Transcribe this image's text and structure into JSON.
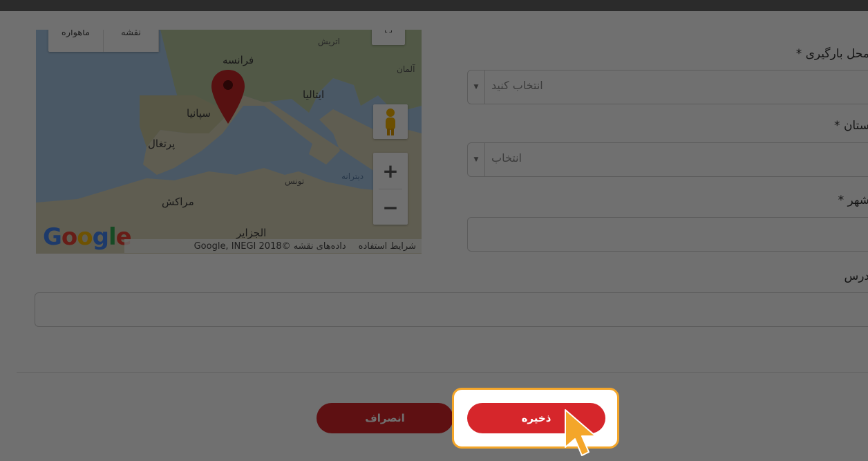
{
  "form": {
    "loading_place_label": "محل بارگیری *",
    "loading_place_placeholder": "انتخاب کنید",
    "province_label": "ستان *",
    "province_placeholder": "انتخاب",
    "city_label": "شهر *",
    "city_value": "",
    "address_label": "درس",
    "address_value": ""
  },
  "map": {
    "type_tabs": [
      "ماهواره",
      "نقشه"
    ],
    "places": {
      "france": "فرانسه",
      "spain": "سپانیا",
      "portugal": "پرتغال",
      "italy": "ایتالیا",
      "morocco": "مراکش",
      "tunisia": "تونس",
      "algeria": "الجزایر",
      "germany": "آلمان",
      "austria": "اتریش",
      "med_sea": "دیترانه"
    },
    "google_logo": "Google",
    "attribution_data": "داده‌های نقشه ©2018 Google, INEGI",
    "attribution_terms": "شرایط استفاده",
    "zoom_in": "+",
    "zoom_out": "−"
  },
  "buttons": {
    "cancel": "انصراف",
    "save": "ذخیره"
  },
  "colors": {
    "primary": "#d6262b",
    "highlight": "#f4a62a"
  }
}
